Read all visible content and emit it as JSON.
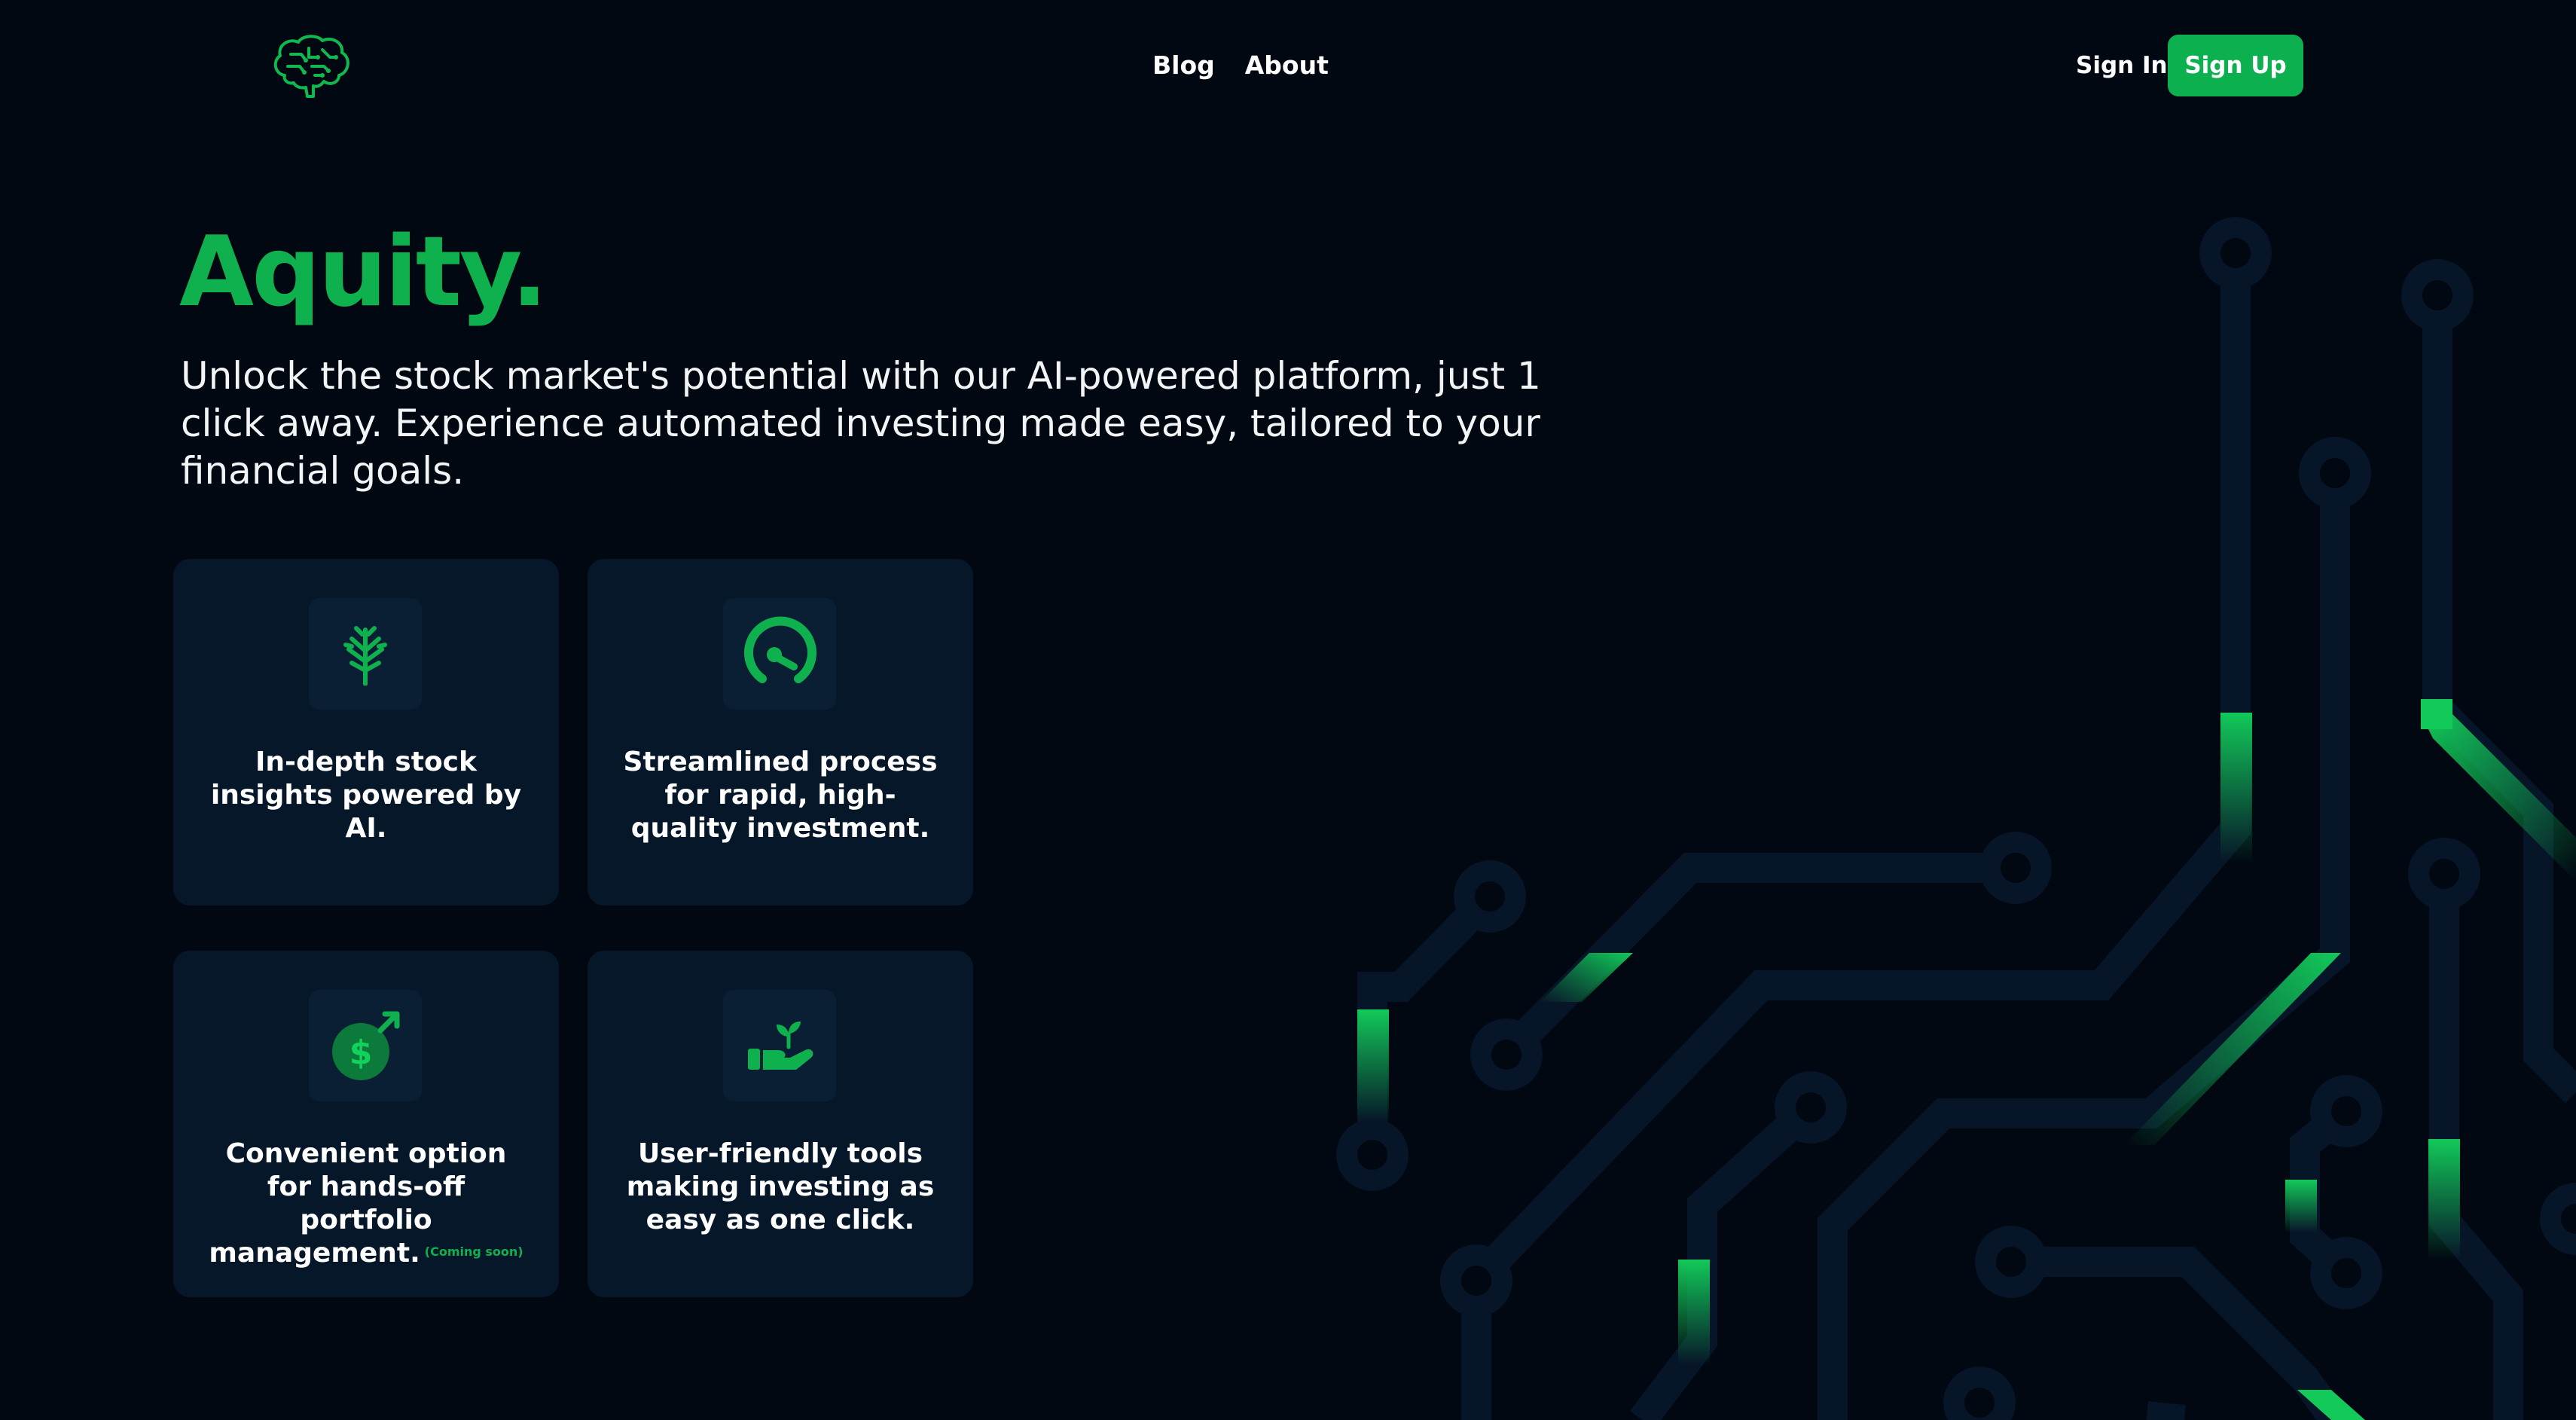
{
  "nav": {
    "logo_name": "brain-logo",
    "links": [
      {
        "label": "Blog"
      },
      {
        "label": "About"
      }
    ],
    "sign_in": "Sign In",
    "sign_up": "Sign Up"
  },
  "hero": {
    "title": "Aquity.",
    "subtitle": "Unlock the stock market's potential with our AI-powered platform, just 1 click away. Experience automated investing made easy, tailored to your financial goals."
  },
  "features": [
    {
      "icon": "branch-tree-icon",
      "text": "In-depth stock insights powered by AI.",
      "badge": ""
    },
    {
      "icon": "speedometer-icon",
      "text": "Streamlined process for rapid, high-quality investment.",
      "badge": ""
    },
    {
      "icon": "dollar-growth-icon",
      "text": "Convenient option for hands-off portfolio management.",
      "badge": "(Coming soon)"
    },
    {
      "icon": "hand-plant-icon",
      "text": "User-friendly tools making investing as easy as one click.",
      "badge": ""
    }
  ],
  "colors": {
    "background": "#010812",
    "accent": "#0fb14f",
    "card": "#06172a",
    "circuit_trace": "#071528"
  }
}
